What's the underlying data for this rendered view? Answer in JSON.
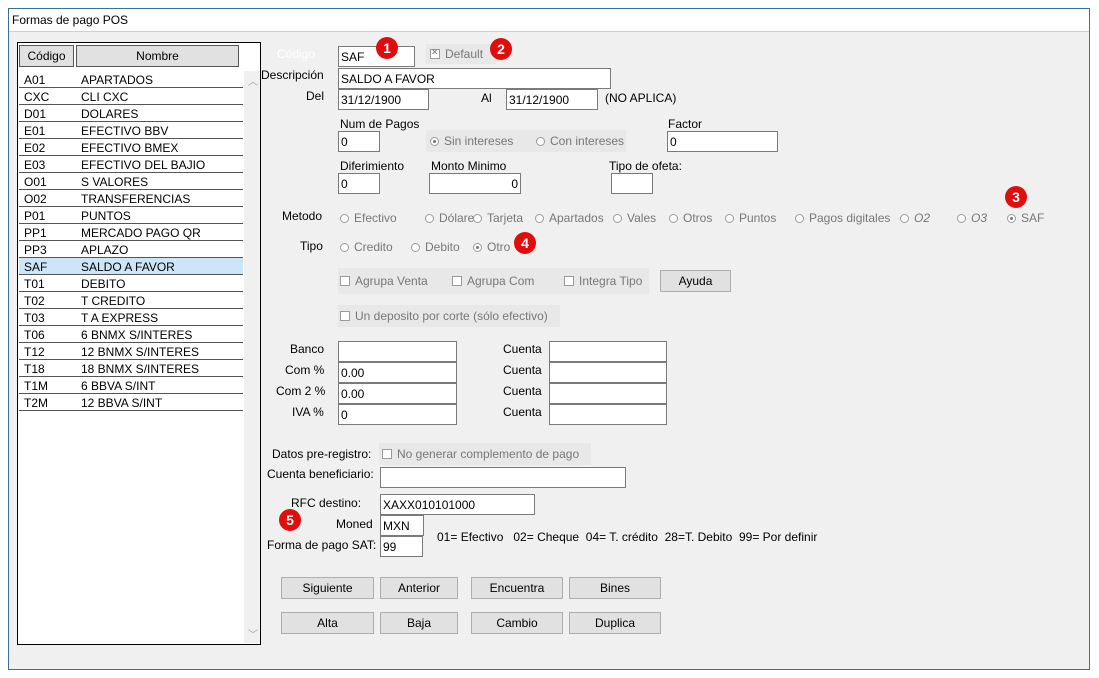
{
  "window": {
    "title": "Formas de pago POS"
  },
  "list": {
    "headers": {
      "codigo": "Código",
      "nombre": "Nombre"
    },
    "rows": [
      {
        "code": "A01",
        "name": "APARTADOS"
      },
      {
        "code": "CXC",
        "name": "CLI CXC"
      },
      {
        "code": "D01",
        "name": "DOLARES"
      },
      {
        "code": "E01",
        "name": "EFECTIVO BBV"
      },
      {
        "code": "E02",
        "name": "EFECTIVO BMEX"
      },
      {
        "code": "E03",
        "name": "EFECTIVO DEL BAJIO"
      },
      {
        "code": "O01",
        "name": "S VALORES"
      },
      {
        "code": "O02",
        "name": "TRANSFERENCIAS"
      },
      {
        "code": "P01",
        "name": "PUNTOS"
      },
      {
        "code": "PP1",
        "name": "MERCADO PAGO QR"
      },
      {
        "code": "PP3",
        "name": "APLAZO"
      },
      {
        "code": "SAF",
        "name": "SALDO A FAVOR"
      },
      {
        "code": "T01",
        "name": "DEBITO"
      },
      {
        "code": "T02",
        "name": "T CREDITO"
      },
      {
        "code": "T03",
        "name": "T A EXPRESS"
      },
      {
        "code": "T06",
        "name": "6 BNMX S/INTERES"
      },
      {
        "code": "T12",
        "name": "12 BNMX S/INTERES"
      },
      {
        "code": "T18",
        "name": "18 BNMX S/INTERES"
      },
      {
        "code": "T1M",
        "name": "6 BBVA  S/INT"
      },
      {
        "code": "T2M",
        "name": "12 BBVA S/INT"
      }
    ],
    "selected_code": "SAF"
  },
  "form": {
    "codigo_label": "Código",
    "codigo_value": "SAF",
    "default_label": "Default",
    "descripcion_label": "Descripción",
    "descripcion_value": "SALDO A FAVOR",
    "del_label": "Del",
    "del_value": "31/12/1900",
    "al_label": "Al",
    "al_value": "31/12/1900",
    "no_aplica": "(NO APLICA)",
    "num_pagos_label": "Num de Pagos",
    "num_pagos_value": "0",
    "sin_intereses": "Sin intereses",
    "con_intereses": "Con intereses",
    "factor_label": "Factor",
    "factor_value": "0",
    "diferimiento_label": "Diferimiento",
    "diferimiento_value": "0",
    "monto_minimo_label": "Monto Minimo",
    "monto_minimo_value": "0",
    "tipo_oferta_label": "Tipo de ofeta:",
    "tipo_oferta_value": "",
    "metodo_label": "Metodo",
    "metodo_options": [
      "Efectivo",
      "Dólares",
      "Tarjeta",
      "Apartados",
      "Vales",
      "Otros",
      "Puntos",
      "Pagos digitales",
      "O2",
      "O3",
      "SAF"
    ],
    "metodo_selected": "SAF",
    "tipo_label": "Tipo",
    "tipo_options": [
      "Credito",
      "Debito",
      "Otro"
    ],
    "tipo_selected": "Otro",
    "agrupa_venta": "Agrupa Venta",
    "agrupa_com": "Agrupa Com",
    "integra_tipo": "Integra Tipo",
    "ayuda_button": "Ayuda",
    "un_deposito": "Un deposito por corte (sólo efectivo)",
    "banco_label": "Banco",
    "banco_value": "",
    "com_pct_label": "Com %",
    "com_pct_value": "0.00",
    "com2_pct_label": "Com 2 %",
    "com2_pct_value": "0.00",
    "iva_pct_label": "IVA %",
    "iva_pct_value": "0",
    "cuenta_label": "Cuenta",
    "cuenta_values": [
      "",
      "",
      "",
      ""
    ],
    "datos_preregistro_label": "Datos pre-registro:",
    "no_generar": "No generar complemento de pago",
    "cuenta_beneficiario_label": "Cuenta beneficiario:",
    "cuenta_beneficiario_value": "",
    "rfc_destino_label": "RFC destino:",
    "rfc_destino_value": "XAXX010101000",
    "moneda_label": "Moned",
    "moneda_value": "MXN",
    "forma_pago_sat_label": "Forma de pago SAT:",
    "forma_pago_sat_value": "99",
    "sat_legend": "01= Efectivo   02= Cheque  04= T. crédito  28=T. Debito  99= Por definir"
  },
  "buttons": {
    "siguiente": "Siguiente",
    "anterior": "Anterior",
    "encuentra": "Encuentra",
    "bines": "Bines",
    "alta": "Alta",
    "baja": "Baja",
    "cambio": "Cambio",
    "duplica": "Duplica"
  },
  "badges": [
    "1",
    "2",
    "3",
    "4",
    "5"
  ],
  "colors": {
    "badge": "#e00d0d",
    "selected_row": "#cde6f7",
    "window_border": "#3c6fa0"
  }
}
